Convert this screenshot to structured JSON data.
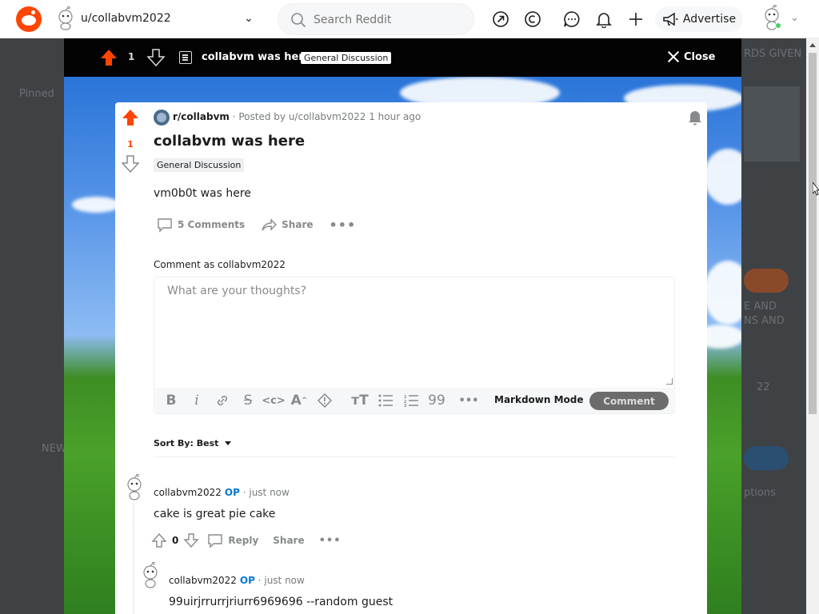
{
  "topbar": {
    "community": "u/collabvm2022",
    "search_placeholder": "Search Reddit",
    "advertise_label": "Advertise"
  },
  "modal_header": {
    "score": "1",
    "title": "collabvm was here",
    "flair": "General Discussion",
    "close_label": "Close"
  },
  "post": {
    "subreddit": "r/collabvm",
    "posted_by": "· Posted by u/collabvm2022 1 hour ago",
    "score": "1",
    "title": "collabvm was here",
    "flair": "General Discussion",
    "body": "vm0b0t was here",
    "comments_label": "5 Comments",
    "share_label": "Share"
  },
  "composer": {
    "comment_as": "Comment as collabvm2022",
    "placeholder": "What are your thoughts?",
    "markdown_mode": "Markdown Mode",
    "submit_label": "Comment"
  },
  "sort": {
    "label": "Sort By: Best"
  },
  "comments": [
    {
      "author": "collabvm2022",
      "op": "OP",
      "time": " · just now",
      "body": "cake is great pie cake",
      "score": "0",
      "reply_label": "Reply",
      "share_label": "Share"
    },
    {
      "author": "collabvm2022",
      "op": "OP",
      "time": " · just now",
      "body": "99uirjrrurrjriurr6969696 --random guest"
    }
  ],
  "backdrop_fragments": {
    "pinned": "Pinned",
    "new": "NEW",
    "awards": "RDS GIVEN",
    "lines": "E AND\nNS AND",
    "options": "ptions",
    "count": "22"
  },
  "colors": {
    "brand": "#ff4500",
    "op": "#0079d3",
    "upvote": "#ff4500"
  }
}
